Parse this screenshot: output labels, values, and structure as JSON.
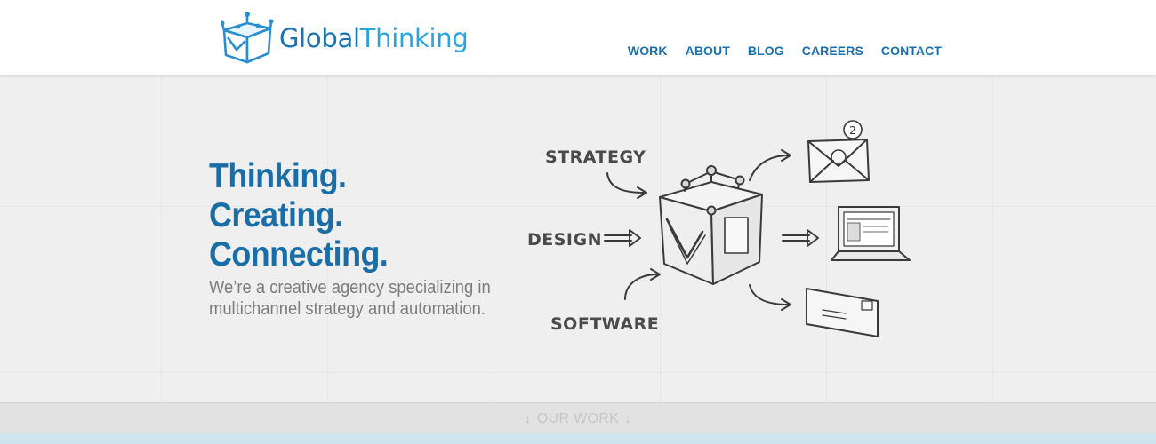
{
  "brand": {
    "name_part1": "Global",
    "name_part2": "Thinking"
  },
  "nav": {
    "items": [
      {
        "label": "WORK"
      },
      {
        "label": "ABOUT"
      },
      {
        "label": "BLOG"
      },
      {
        "label": "CAREERS"
      },
      {
        "label": "CONTACT"
      }
    ]
  },
  "hero": {
    "headline": [
      "Thinking.",
      "Creating.",
      "Connecting."
    ],
    "tagline": [
      "We’re a creative agency specializing in",
      "multichannel strategy and automation."
    ],
    "sketch_labels": {
      "strategy": "STRATEGY",
      "design": "DESIGN",
      "software": "SOFTWARE"
    },
    "email_badge": "2"
  },
  "ourwork": {
    "label": "OUR WORK"
  },
  "colors": {
    "brand_dark": "#1a72b1",
    "brand_light": "#29a3e0",
    "nav": "#1a6fae",
    "tagline": "#7c7c7c"
  }
}
